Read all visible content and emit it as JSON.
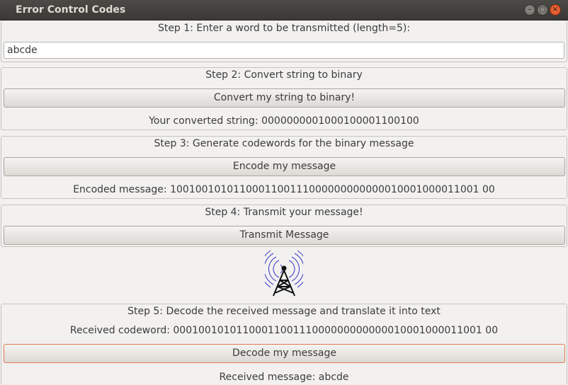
{
  "window": {
    "title": "Error Control Codes"
  },
  "step1": {
    "label": "Step 1: Enter a word to be transmitted (length=5):",
    "input_value": "abcde"
  },
  "step2": {
    "label": "Step 2: Convert string to binary",
    "button": "Convert my string to binary!",
    "result": "Your converted string: 0000000001000100001100100"
  },
  "step3": {
    "label": "Step 3: Generate codewords for the binary message",
    "button": "Encode my message",
    "result": "Encoded message: 1001001010110001100111000000000000010001000011001 00"
  },
  "step4": {
    "label": "Step 4: Transmit your message!",
    "button": "Transmit Message",
    "icon": "radio-tower-icon"
  },
  "step5": {
    "label": "Step 5: Decode the received message and translate it into text",
    "received_codeword": "Received codeword: 0001001010110001100111000000000000010001000011001 00",
    "button": "Decode my message",
    "result": "Received message: abcde"
  },
  "colors": {
    "window_bg": "#f2f1f0",
    "titlebar": "#3c3b37",
    "close_button": "#e1582b",
    "focus_border": "#e07a52",
    "tower_waves": "#3a39c8"
  }
}
